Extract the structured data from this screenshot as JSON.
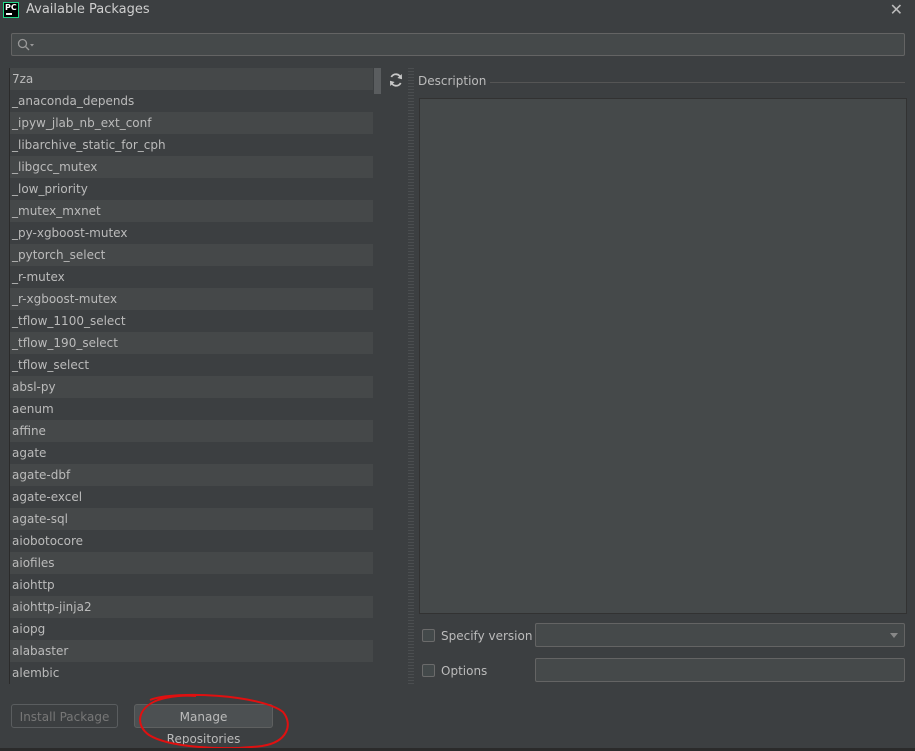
{
  "window": {
    "title": "Available Packages",
    "app_icon_text": "PC"
  },
  "search": {
    "placeholder": "",
    "value": ""
  },
  "packages": [
    "7za",
    "_anaconda_depends",
    "_ipyw_jlab_nb_ext_conf",
    "_libarchive_static_for_cph",
    "_libgcc_mutex",
    "_low_priority",
    "_mutex_mxnet",
    "_py-xgboost-mutex",
    "_pytorch_select",
    "_r-mutex",
    "_r-xgboost-mutex",
    "_tflow_1100_select",
    "_tflow_190_select",
    "_tflow_select",
    "absl-py",
    "aenum",
    "affine",
    "agate",
    "agate-dbf",
    "agate-excel",
    "agate-sql",
    "aiobotocore",
    "aiofiles",
    "aiohttp",
    "aiohttp-jinja2",
    "aiopg",
    "alabaster",
    "alembic"
  ],
  "description": {
    "label": "Description",
    "text": ""
  },
  "specify_version": {
    "label": "Specify version",
    "checked": false,
    "value": ""
  },
  "options": {
    "label": "Options",
    "checked": false,
    "value": ""
  },
  "buttons": {
    "install": "Install Package",
    "manage": "Manage Repositories"
  },
  "colors": {
    "background": "#3c3f41",
    "row_alt": "#454849",
    "text": "#bbbbbb",
    "annotation": "#e01010",
    "app_icon_accent": "#21d789"
  }
}
